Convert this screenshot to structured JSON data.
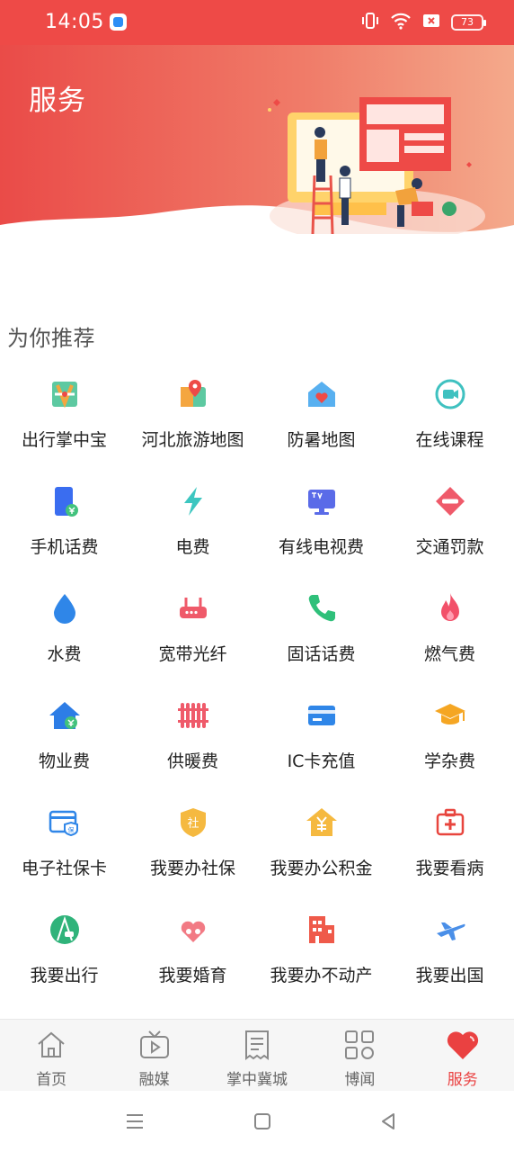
{
  "status_bar": {
    "time": "14:05",
    "battery": "73",
    "icons": [
      "app-notification-icon",
      "vibrate-icon",
      "wifi-icon",
      "no-sim-icon",
      "battery-icon"
    ]
  },
  "banner": {
    "title": "服务"
  },
  "recommend": {
    "title": "为你推荐",
    "items": [
      {
        "label": "出行掌中宝",
        "icon": "metro-map-icon"
      },
      {
        "label": "河北旅游地图",
        "icon": "map-pin-icon"
      },
      {
        "label": "防暑地图",
        "icon": "house-heart-icon"
      },
      {
        "label": "在线课程",
        "icon": "video-camera-icon"
      },
      {
        "label": "手机话费",
        "icon": "phone-yuan-icon"
      },
      {
        "label": "电费",
        "icon": "lightning-icon"
      },
      {
        "label": "有线电视费",
        "icon": "tv-icon"
      },
      {
        "label": "交通罚款",
        "icon": "no-entry-icon"
      },
      {
        "label": "水费",
        "icon": "water-drop-icon"
      },
      {
        "label": "宽带光纤",
        "icon": "router-icon"
      },
      {
        "label": "固话话费",
        "icon": "telephone-icon"
      },
      {
        "label": "燃气费",
        "icon": "flame-icon"
      },
      {
        "label": "物业费",
        "icon": "house-yuan-icon"
      },
      {
        "label": "供暖费",
        "icon": "radiator-icon"
      },
      {
        "label": "IC卡充值",
        "icon": "card-icon"
      },
      {
        "label": "学杂费",
        "icon": "graduation-cap-icon"
      },
      {
        "label": "电子社保卡",
        "icon": "insurance-card-icon"
      },
      {
        "label": "我要办社保",
        "icon": "social-shield-icon"
      },
      {
        "label": "我要办公积金",
        "icon": "house-fund-icon"
      },
      {
        "label": "我要看病",
        "icon": "medical-kit-icon"
      },
      {
        "label": "我要出行",
        "icon": "road-car-icon"
      },
      {
        "label": "我要婚育",
        "icon": "couple-heart-icon"
      },
      {
        "label": "我要办不动产",
        "icon": "building-icon"
      },
      {
        "label": "我要出国",
        "icon": "airplane-icon"
      }
    ]
  },
  "bottom_nav": {
    "active_index": 4,
    "items": [
      {
        "label": "首页",
        "icon": "home-icon"
      },
      {
        "label": "融媒",
        "icon": "media-play-icon"
      },
      {
        "label": "掌中冀城",
        "icon": "document-icon"
      },
      {
        "label": "博闻",
        "icon": "grid-icon"
      },
      {
        "label": "服务",
        "icon": "heart-icon"
      }
    ]
  },
  "colors": {
    "brand_red": "#ee4a47",
    "active_nav": "#ea4141"
  }
}
